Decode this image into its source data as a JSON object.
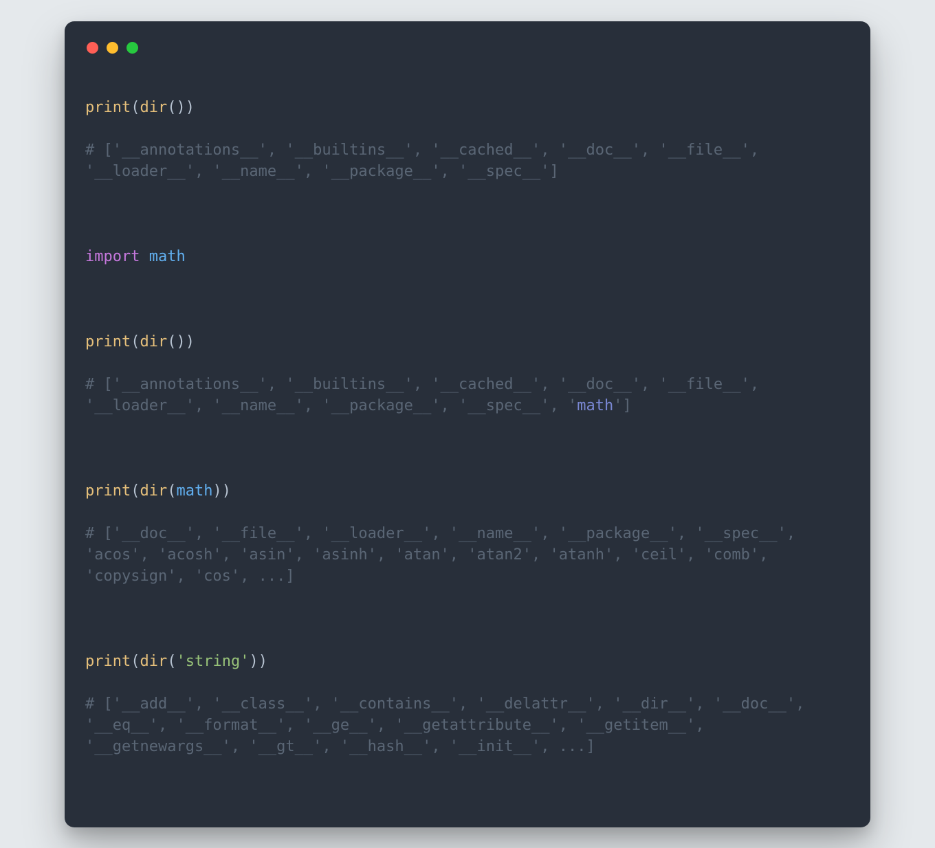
{
  "traffic": {
    "close": "close",
    "min": "minimize",
    "max": "maximize"
  },
  "code": {
    "print": "print",
    "dir": "dir",
    "lparen": "(",
    "rparen": ")",
    "import": "import",
    "math": "math",
    "string_literal": "'string'",
    "comment1": "# ['__annotations__', '__builtins__', '__cached__', '__doc__', '__file__', '__loader__', '__name__', '__package__', '__spec__']",
    "comment2_pre": "# ['__annotations__', '__builtins__', '__cached__', '__doc__', '__file__', '__loader__', '__name__', '__package__', '__spec__', '",
    "comment2_math": "math",
    "comment2_post": "']",
    "comment3": "# ['__doc__', '__file__', '__loader__', '__name__', '__package__', '__spec__', 'acos', 'acosh', 'asin', 'asinh', 'atan', 'atan2', 'atanh', 'ceil', 'comb', 'copysign', 'cos', ...]",
    "comment4": "# ['__add__', '__class__', '__contains__', '__delattr__', '__dir__', '__doc__', '__eq__', '__format__', '__ge__', '__getattribute__', '__getitem__', '__getnewargs__', '__gt__', '__hash__', '__init__', ...]"
  }
}
